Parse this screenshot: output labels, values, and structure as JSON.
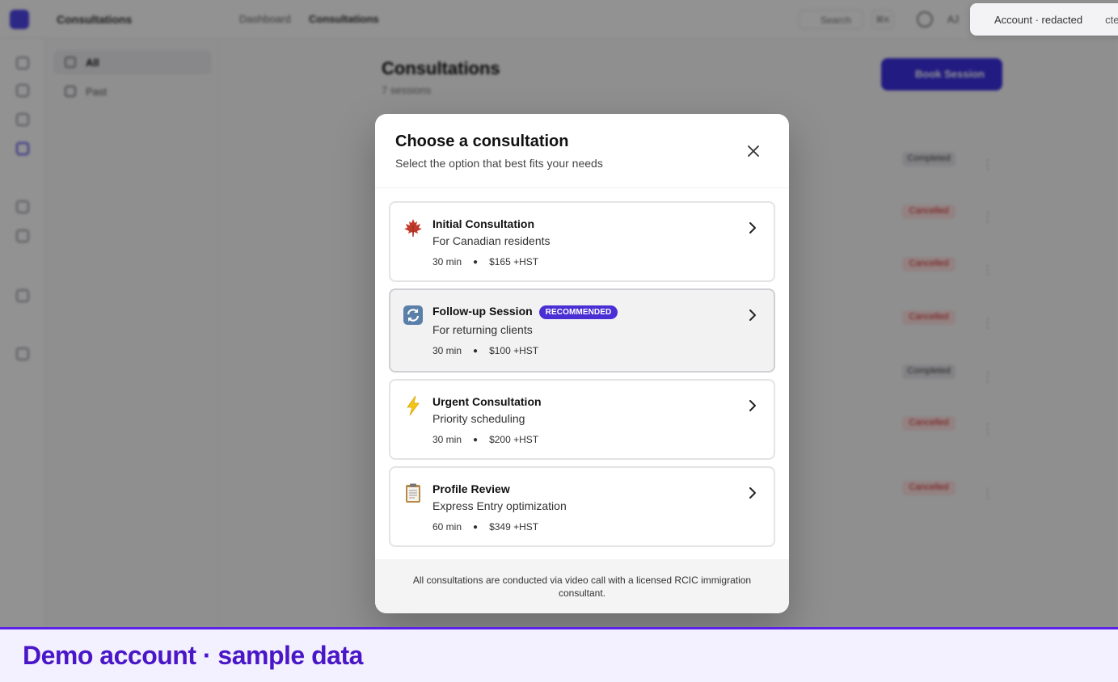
{
  "app": {
    "workspace": "Consultations",
    "breadcrumb": [
      "Dashboard",
      "Consultations"
    ],
    "search_label": "Search",
    "search_kbd": "⌘K",
    "user_initials": "AJ",
    "page_title": "Consultations",
    "page_subtitle": "7 sessions",
    "book_button_label": "Book Session",
    "subnav": [
      {
        "label": "All"
      },
      {
        "label": "Past"
      }
    ],
    "rows": [
      {
        "status": "Completed"
      },
      {
        "status": "Cancelled"
      },
      {
        "status": "Cancelled"
      },
      {
        "status": "Cancelled"
      },
      {
        "status": "Completed"
      },
      {
        "status": "Cancelled"
      },
      {
        "status": "Cancelled"
      }
    ]
  },
  "toast": {
    "text": "Account · redacted",
    "extra": "cte"
  },
  "modal": {
    "title": "Choose a consultation",
    "subtitle": "Select the option that best fits your needs",
    "options": [
      {
        "icon": "maple-leaf-icon",
        "name": "Initial Consultation",
        "description": "For Canadian residents",
        "duration": "30 min",
        "price": "$165 +HST",
        "badge": ""
      },
      {
        "icon": "refresh-icon",
        "name": "Follow-up Session",
        "description": "For returning clients",
        "duration": "30 min",
        "price": "$100 +HST",
        "badge": "RECOMMENDED"
      },
      {
        "icon": "lightning-icon",
        "name": "Urgent Consultation",
        "description": "Priority scheduling",
        "duration": "30 min",
        "price": "$200 +HST",
        "badge": ""
      },
      {
        "icon": "clipboard-icon",
        "name": "Profile Review",
        "description": "Express Entry optimization",
        "duration": "60 min",
        "price": "$349 +HST",
        "badge": ""
      }
    ],
    "footer": "All consultations are conducted via video call with a licensed RCIC immigration consultant."
  },
  "demo_banner": "Demo account · sample data",
  "colors": {
    "accent": "#4a2fd4",
    "demo_text": "#4a17c8",
    "demo_border": "#5b21e8"
  }
}
